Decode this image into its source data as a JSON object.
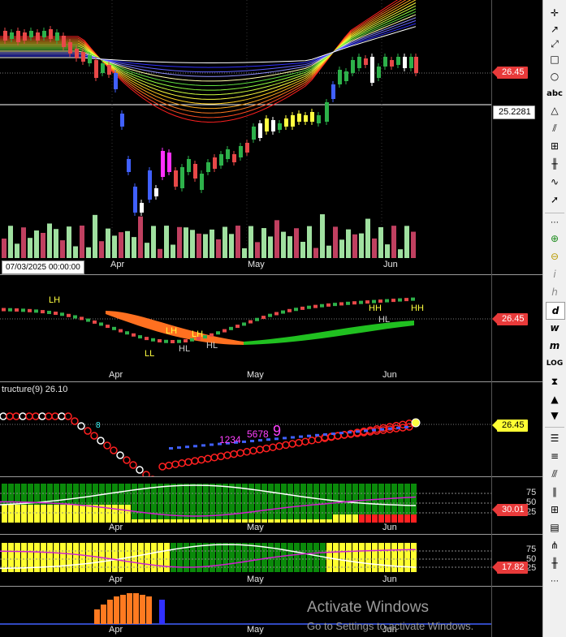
{
  "main_pane": {
    "price_labels": {
      "last": "26.45",
      "hline": "25.2281"
    },
    "crosshair_date": "07/03/2025 00:00:00",
    "months": [
      "Apr",
      "May",
      "Jun"
    ]
  },
  "structure_pane": {
    "labels": [
      "LH",
      "LH",
      "LH",
      "LL",
      "HL",
      "HL",
      "HH",
      "HH",
      "HL"
    ],
    "price_label": "26.45",
    "months": [
      "Apr",
      "May",
      "Jun"
    ]
  },
  "indicator_pane": {
    "title": "tructure(9) 26.10",
    "count_label": "1234",
    "count_label2": "5678",
    "count_nine": "9",
    "count_small": "8",
    "price_label": "26.45"
  },
  "osc1_pane": {
    "scale": [
      "75",
      "50",
      "25"
    ],
    "value_label": "30.01",
    "months": [
      "Apr",
      "May",
      "Jun"
    ]
  },
  "osc2_pane": {
    "scale": [
      "75",
      "50",
      "25"
    ],
    "value_label": "17.82",
    "months": [
      "Apr",
      "May",
      "Jun"
    ]
  },
  "bottom_pane": {
    "months": [
      "Apr",
      "May",
      "Jun"
    ]
  },
  "watermark": {
    "title": "Activate Windows",
    "subtitle": "Go to Settings to activate Windows."
  },
  "toolbar": {
    "text_tool": "abc",
    "log_label": "LOG",
    "italic_i": "i",
    "italic_h": "h",
    "italic_d": "d",
    "italic_w": "w",
    "italic_m": "m"
  },
  "colors": {
    "up": "#2db14a",
    "down": "#e84848",
    "label_red": "#e83a3a",
    "label_yellow": "#ffff33"
  }
}
